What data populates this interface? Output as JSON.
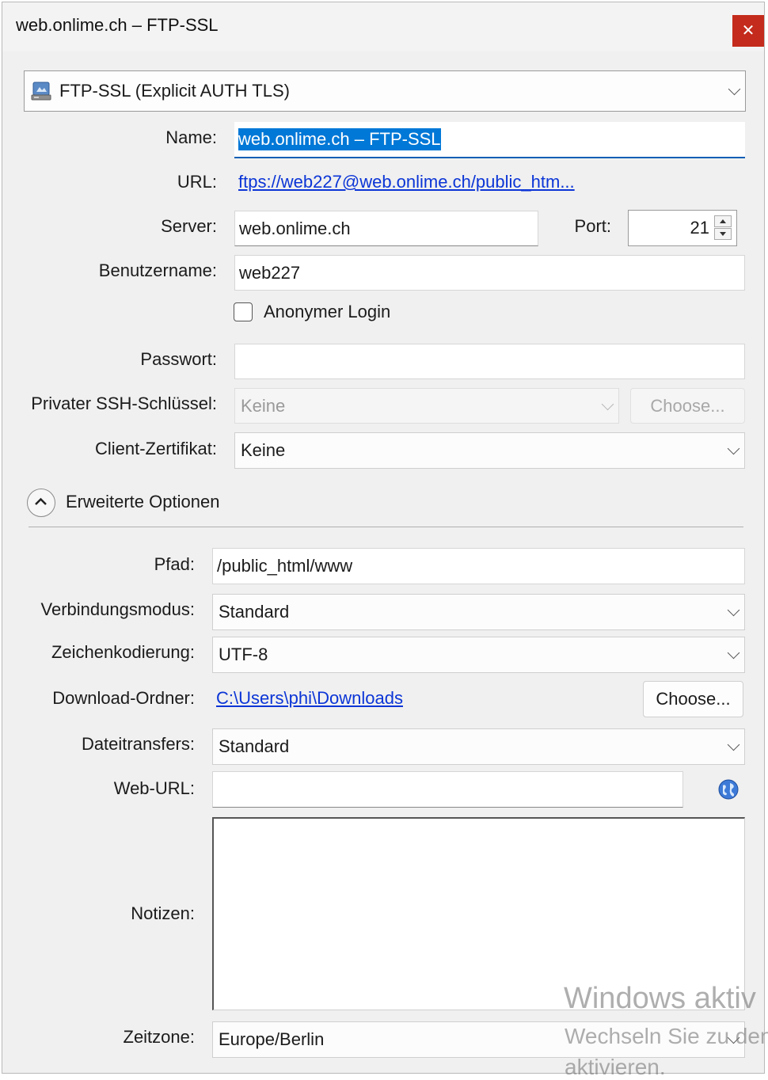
{
  "window": {
    "title": "web.onlime.ch – FTP-SSL",
    "close_glyph": "✕"
  },
  "protocol": {
    "selected": "FTP-SSL (Explicit AUTH TLS)",
    "icon": "server-icon"
  },
  "form": {
    "name_label": "Name:",
    "name_value": "web.onlime.ch – FTP-SSL",
    "url_label": "URL:",
    "url_value": "ftps://web227@web.onlime.ch/public_htm...",
    "server_label": "Server:",
    "server_value": "web.onlime.ch",
    "port_label": "Port:",
    "port_value": "21",
    "username_label": "Benutzername:",
    "username_value": "web227",
    "anonymous_label": "Anonymer Login",
    "password_label": "Passwort:",
    "password_value": "",
    "ssh_key_label": "Privater SSH-Schlüssel:",
    "ssh_key_value": "Keine",
    "ssh_choose_label": "Choose...",
    "client_cert_label": "Client-Zertifikat:",
    "client_cert_value": "Keine"
  },
  "advanced": {
    "toggle_label": "Erweiterte Optionen",
    "path_label": "Pfad:",
    "path_value": "/public_html/www",
    "connection_mode_label": "Verbindungsmodus:",
    "connection_mode_value": "Standard",
    "encoding_label": "Zeichenkodierung:",
    "encoding_value": "UTF-8",
    "download_folder_label": "Download-Ordner:",
    "download_folder_value": "C:\\Users\\phi\\Downloads",
    "download_choose_label": "Choose...",
    "transfers_label": "Dateitransfers:",
    "transfers_value": "Standard",
    "web_url_label": "Web-URL:",
    "web_url_value": "",
    "notes_label": "Notizen:",
    "timezone_label": "Zeitzone:",
    "timezone_value": "Europe/Berlin"
  },
  "watermark": {
    "line1": "Windows aktiv",
    "line2": "Wechseln Sie zu den",
    "line3": "aktivieren."
  },
  "colors": {
    "accent": "#0a5fb4",
    "link": "#0b35d6",
    "close": "#c42b1c",
    "selection": "#0078d7"
  }
}
